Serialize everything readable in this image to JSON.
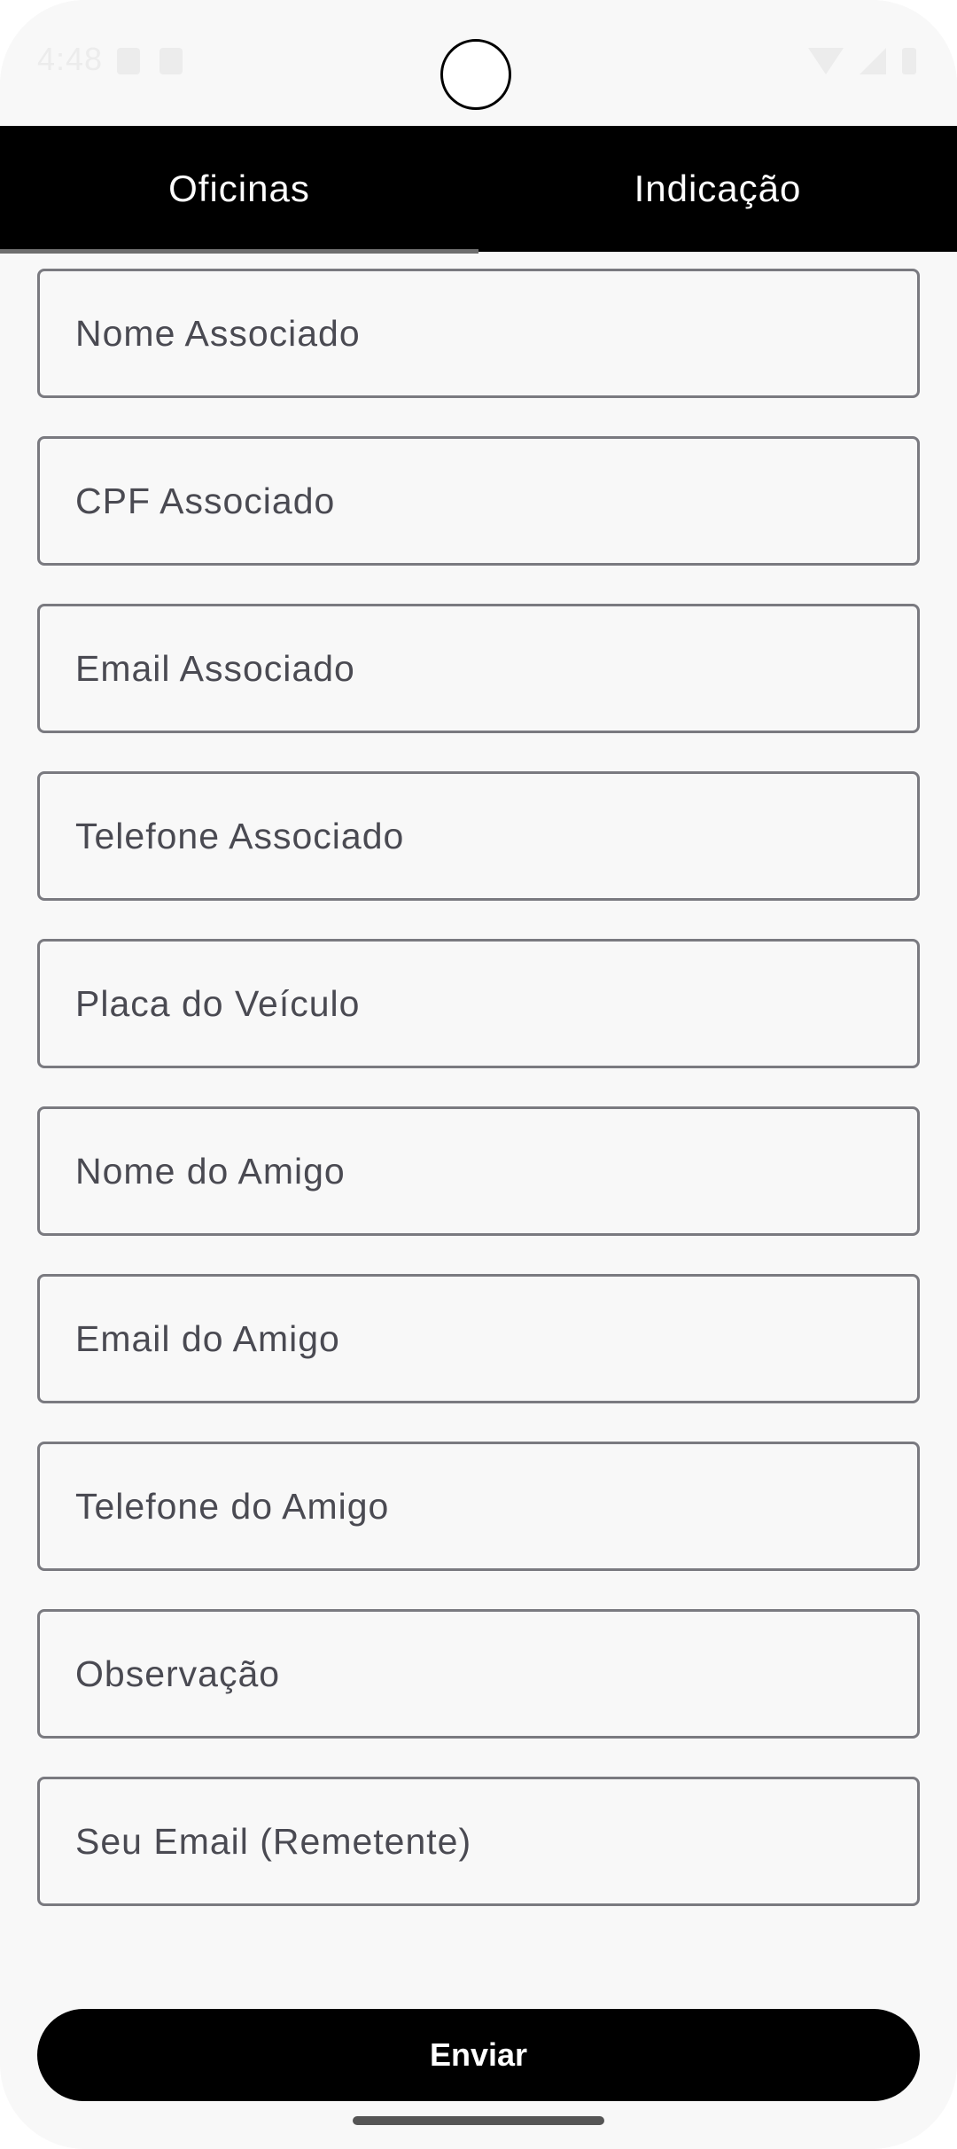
{
  "status_bar": {
    "time": "4:48"
  },
  "tabs": [
    {
      "label": "Oficinas",
      "selected": true
    },
    {
      "label": "Indicação",
      "selected": false
    }
  ],
  "form": {
    "fields": [
      {
        "placeholder": "Nome Associado",
        "value": ""
      },
      {
        "placeholder": "CPF Associado",
        "value": ""
      },
      {
        "placeholder": "Email Associado",
        "value": ""
      },
      {
        "placeholder": "Telefone Associado",
        "value": ""
      },
      {
        "placeholder": "Placa do Veículo",
        "value": ""
      },
      {
        "placeholder": "Nome do Amigo",
        "value": ""
      },
      {
        "placeholder": "Email do Amigo",
        "value": ""
      },
      {
        "placeholder": "Telefone do Amigo",
        "value": ""
      },
      {
        "placeholder": "Observação",
        "value": ""
      },
      {
        "placeholder": "Seu Email (Remetente)",
        "value": ""
      }
    ],
    "submit_label": "Enviar"
  },
  "icons": {
    "status_left": [
      "sim-icon",
      "notification-icon"
    ],
    "status_right": [
      "wifi-icon",
      "signal-icon",
      "battery-icon"
    ]
  },
  "colors": {
    "tab_bar_bg": "#000000",
    "button_bg": "#000000",
    "background": "#f8f8f8",
    "field_border": "#7a7a80"
  }
}
